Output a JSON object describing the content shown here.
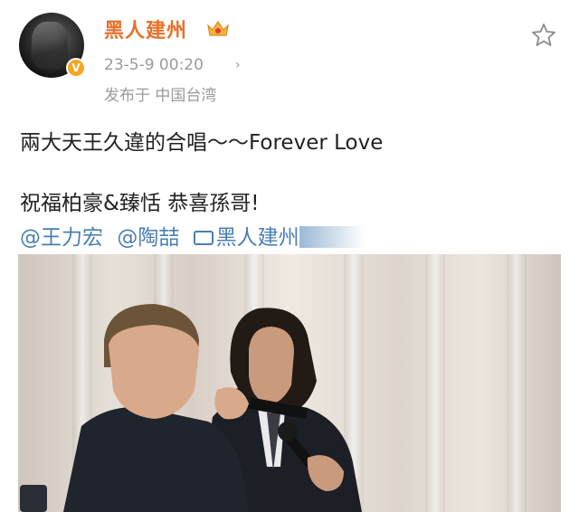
{
  "user": {
    "name": "黑人建州",
    "verified_badge": "V",
    "crown_icon": "crown-icon"
  },
  "meta": {
    "timestamp": "23-5-9 00:20",
    "arrow": "›",
    "location": "发布于 中国台湾"
  },
  "post": {
    "line1": "兩大天王久違的合唱～～Forever Love",
    "line2": "祝福柏豪&臻恬 恭喜孫哥!",
    "mentions": [
      "@王力宏",
      "@陶喆"
    ],
    "video_link_label": "黑人建州"
  },
  "colors": {
    "username": "#e8702a",
    "link": "#4a7fb5",
    "meta": "#9a9a9a",
    "verified": "#f6a623"
  },
  "icons": [
    "star-icon",
    "crown-icon",
    "video-icon",
    "verified-icon"
  ]
}
